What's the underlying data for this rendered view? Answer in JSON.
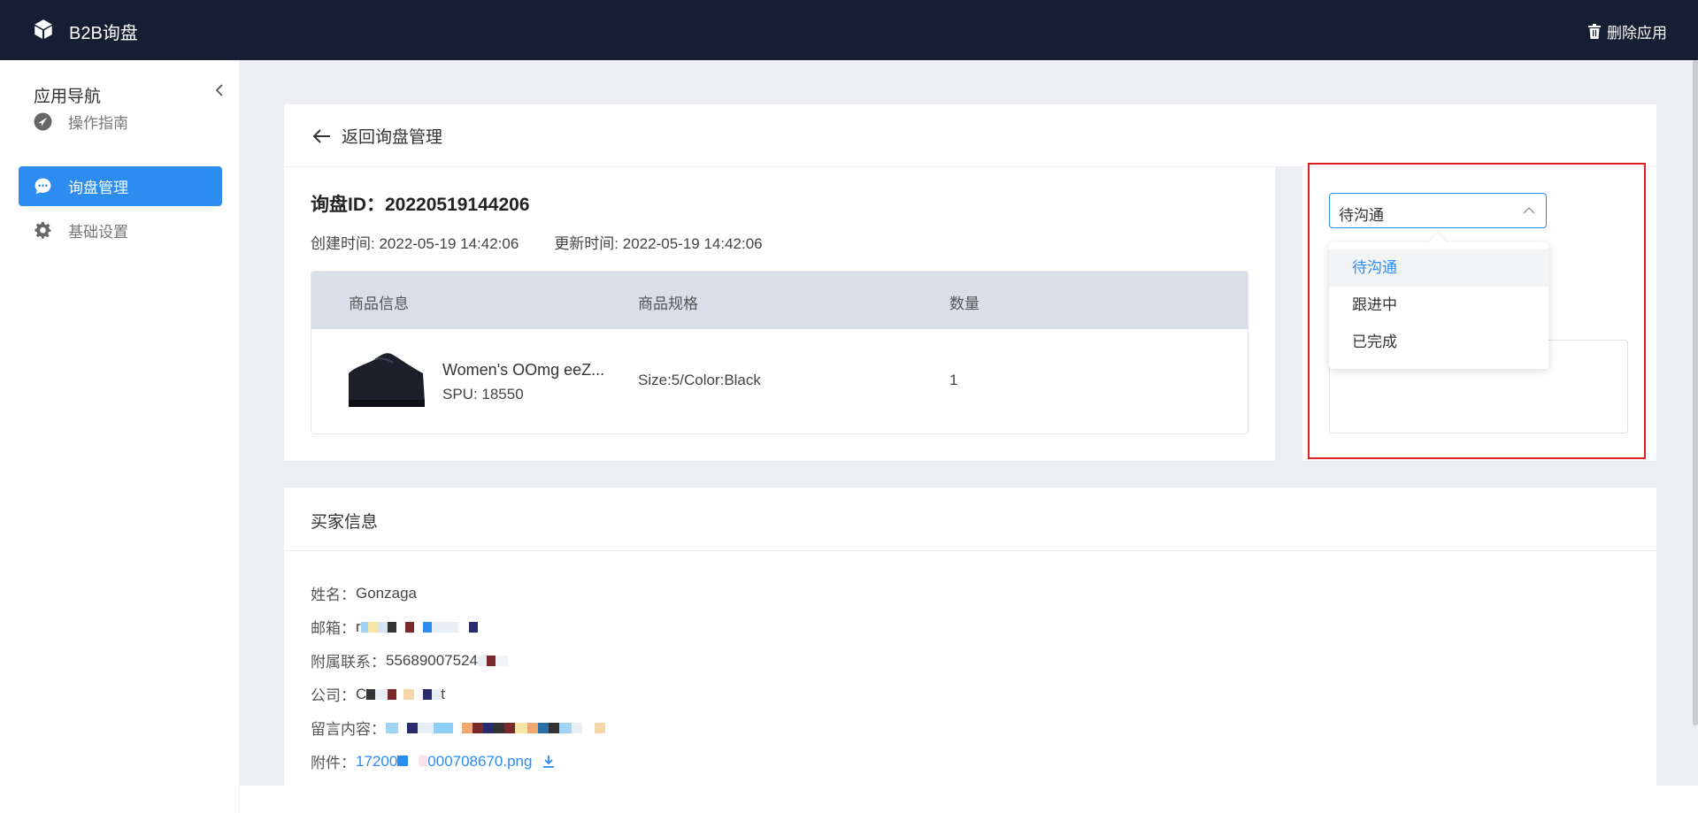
{
  "app": {
    "title": "B2B询盘",
    "delete_label": "删除应用"
  },
  "sidebar": {
    "title": "应用导航",
    "items": [
      {
        "label": "操作指南",
        "icon": "navigation-icon"
      },
      {
        "label": "询盘管理",
        "icon": "chat-icon",
        "active": true
      },
      {
        "label": "基础设置",
        "icon": "gear-icon"
      }
    ]
  },
  "detail": {
    "back_label": "返回询盘管理",
    "inquiry_id_label": "询盘ID：",
    "inquiry_id": "20220519144206",
    "created_label": "创建时间: ",
    "created": "2022-05-19 14:42:06",
    "updated_label": "更新时间: ",
    "updated": "2022-05-19 14:42:06",
    "table": {
      "headers": [
        "商品信息",
        "商品规格",
        "数量"
      ],
      "rows": [
        {
          "name": "Women's OOmg eeZ...",
          "spu": "SPU: 18550",
          "spec": "Size:5/Color:Black",
          "qty": "1"
        }
      ]
    }
  },
  "status": {
    "selected": "待沟通",
    "options": [
      "待沟通",
      "跟进中",
      "已完成"
    ]
  },
  "buyer": {
    "title": "买家信息",
    "name_label": "姓名：",
    "name": "Gonzaga",
    "email_label": "邮箱：",
    "email_prefix": "r",
    "phone_label": "附属联系：",
    "phone": "55689007524",
    "company_label": "公司：",
    "company_prefix": "C",
    "company_suffix": "t",
    "message_label": "留言内容：",
    "attachment_label": "附件：",
    "attachment": "17200",
    "attachment_suffix": "000708670.png"
  },
  "colors": {
    "topbar": "#151e33",
    "accent": "#2d8cf0",
    "highlight_border": "#e02020",
    "background": "#eceef2"
  }
}
